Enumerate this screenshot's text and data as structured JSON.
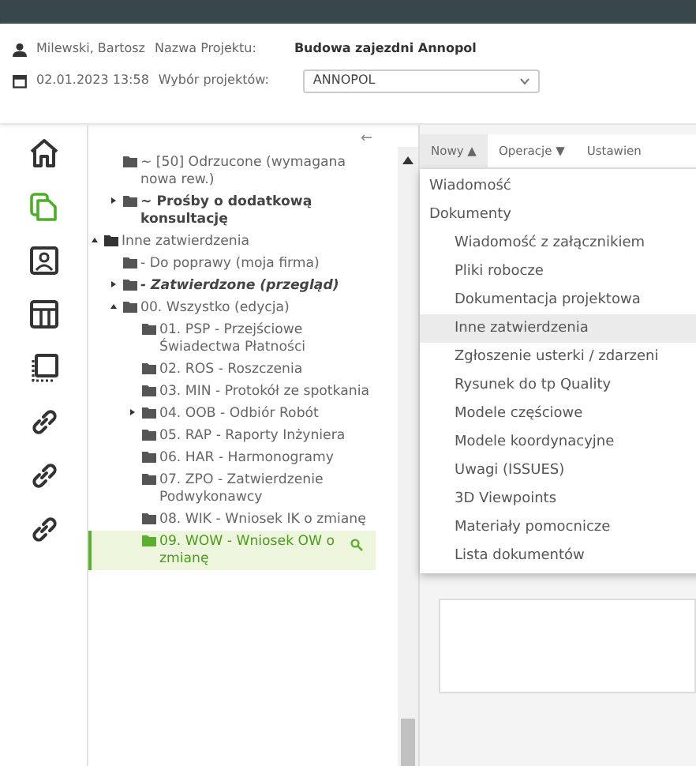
{
  "header": {
    "user": "Milewski, Bartosz",
    "project_label": "Nazwa Projektu:",
    "project_name": "Budowa zajezdni Annopol",
    "datetime": "02.01.2023 13:58",
    "picker_label": "Wybór projektów:",
    "picker_value": "ANNOPOL"
  },
  "sidebar": [
    {
      "kind": "home",
      "selected": false
    },
    {
      "kind": "documents",
      "selected": true
    },
    {
      "kind": "contact",
      "selected": false
    },
    {
      "kind": "table",
      "selected": false
    },
    {
      "kind": "selection",
      "selected": false
    },
    {
      "kind": "link",
      "selected": false
    },
    {
      "kind": "link",
      "selected": false
    },
    {
      "kind": "link",
      "selected": false
    }
  ],
  "tree": {
    "collapse": "←",
    "items": [
      {
        "label": "~ [50] Odrzucone (wymagana nowa rew.)",
        "bold": false,
        "italic": false,
        "selected": false,
        "indent": true
      },
      {
        "label": "~ Prośby o dodatkową konsultację",
        "bold": true,
        "italic": false,
        "selected": false,
        "indent": true,
        "expanded": false
      },
      {
        "label": "Inne zatwierdzenia",
        "bold": false,
        "italic": false,
        "selected": false,
        "expanded": true,
        "children": [
          {
            "label": "- Do poprawy (moja firma)",
            "bold": false,
            "italic": false,
            "selected": false
          },
          {
            "label": "- Zatwierdzone (przegląd)",
            "bold": true,
            "italic": true,
            "selected": false,
            "expanded": false
          },
          {
            "label": "00. Wszystko (edycja)",
            "bold": false,
            "italic": false,
            "selected": false,
            "expanded": true,
            "children": [
              {
                "label": "01. PSP - Przejściowe Świadectwa Płatności",
                "bold": false,
                "italic": false,
                "selected": false
              },
              {
                "label": "02. ROS - Roszczenia",
                "bold": false,
                "italic": false,
                "selected": false
              },
              {
                "label": "03. MIN - Protokół ze spotkania",
                "bold": false,
                "italic": false,
                "selected": false
              },
              {
                "label": "04. OOB - Odbiór Robót",
                "bold": false,
                "italic": false,
                "selected": false,
                "expanded": false
              },
              {
                "label": "05. RAP - Raporty Inżyniera",
                "bold": false,
                "italic": false,
                "selected": false
              },
              {
                "label": "06. HAR - Harmonogramy",
                "bold": false,
                "italic": false,
                "selected": false
              },
              {
                "label": "07. ZPO - Zatwierdzenie Podwykonawcy",
                "bold": false,
                "italic": false,
                "selected": false
              },
              {
                "label": "08. WIK - Wniosek IK o zmianę",
                "bold": false,
                "italic": false,
                "selected": false
              },
              {
                "label": "09. WOW - Wniosek OW o zmianę",
                "bold": false,
                "italic": false,
                "selected": true
              }
            ]
          }
        ]
      }
    ]
  },
  "toolbar": [
    {
      "label": "Nowy ▲",
      "selected": true
    },
    {
      "label": "Operacje ▼",
      "selected": false
    },
    {
      "label": "Ustawien",
      "selected": false
    }
  ],
  "menu": [
    {
      "label": "Wiadomość",
      "kind": "top",
      "selected": false
    },
    {
      "label": "Dokumenty",
      "kind": "top",
      "selected": false
    },
    {
      "label": "Wiadomość z załącznikiem",
      "kind": "sub",
      "selected": false
    },
    {
      "label": "Pliki robocze",
      "kind": "sub",
      "selected": false
    },
    {
      "label": "Dokumentacja projektowa",
      "kind": "sub",
      "selected": false
    },
    {
      "label": "Inne zatwierdzenia",
      "kind": "sub",
      "selected": true
    },
    {
      "label": "Zgłoszenie usterki / zdarzeni",
      "kind": "sub",
      "selected": false
    },
    {
      "label": "Rysunek do tp Quality",
      "kind": "sub",
      "selected": false
    },
    {
      "label": "Modele częściowe",
      "kind": "sub",
      "selected": false
    },
    {
      "label": "Modele koordynacyjne",
      "kind": "sub",
      "selected": false
    },
    {
      "label": "Uwagi (ISSUES)",
      "kind": "sub",
      "selected": false
    },
    {
      "label": "3D Viewpoints",
      "kind": "sub",
      "selected": false
    },
    {
      "label": "Materiały pomocnicze",
      "kind": "sub",
      "selected": false
    },
    {
      "label": "Lista dokumentów",
      "kind": "sub",
      "selected": false
    }
  ]
}
